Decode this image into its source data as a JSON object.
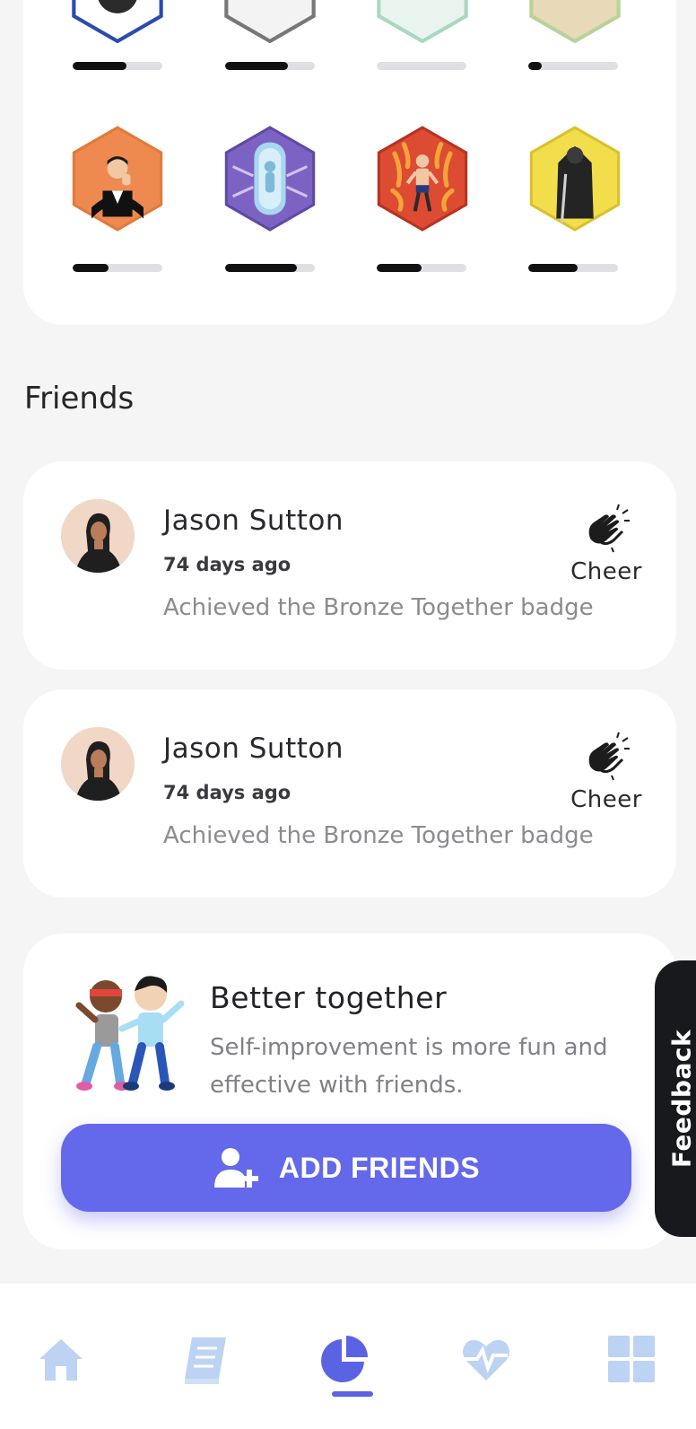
{
  "badges": [
    {
      "name": "badge-top-1",
      "progress": 0.6
    },
    {
      "name": "badge-top-2",
      "progress": 0.7
    },
    {
      "name": "badge-top-3",
      "progress": 0.0
    },
    {
      "name": "badge-top-4",
      "progress": 0.15
    },
    {
      "name": "badge-gentleman",
      "color": "#ee8a50",
      "progress": 0.4
    },
    {
      "name": "badge-cryo",
      "color": "#7c63c3",
      "progress": 0.8
    },
    {
      "name": "badge-fire",
      "color": "#dc4b32",
      "progress": 0.5
    },
    {
      "name": "badge-knight",
      "color": "#f2dd4b",
      "progress": 0.55
    }
  ],
  "friends_section": {
    "title": "Friends"
  },
  "friends": [
    {
      "name": "Jason Sutton",
      "date": "74 days ago",
      "activity": "Achieved the Bronze Together badge",
      "cheer_label": "Cheer"
    },
    {
      "name": "Jason Sutton",
      "date": "74 days ago",
      "activity": "Achieved the Bronze Together badge",
      "cheer_label": "Cheer"
    }
  ],
  "better_together": {
    "title": "Better together",
    "description": "Self-improvement is more fun and effective with friends.",
    "button_label": "ADD FRIENDS"
  },
  "feedback_label": "Feedback",
  "nav": {
    "items": [
      {
        "icon": "home-icon",
        "active": false
      },
      {
        "icon": "journal-icon",
        "active": false
      },
      {
        "icon": "stats-pie-icon",
        "active": true
      },
      {
        "icon": "heart-pulse-icon",
        "active": false
      },
      {
        "icon": "grid-icon",
        "active": false
      }
    ],
    "active_color": "#5b63e5",
    "inactive_color": "#bcd3f3"
  },
  "colors": {
    "accent": "#6468ea",
    "progress_fill": "#111111",
    "progress_track": "#dfe0e3"
  }
}
